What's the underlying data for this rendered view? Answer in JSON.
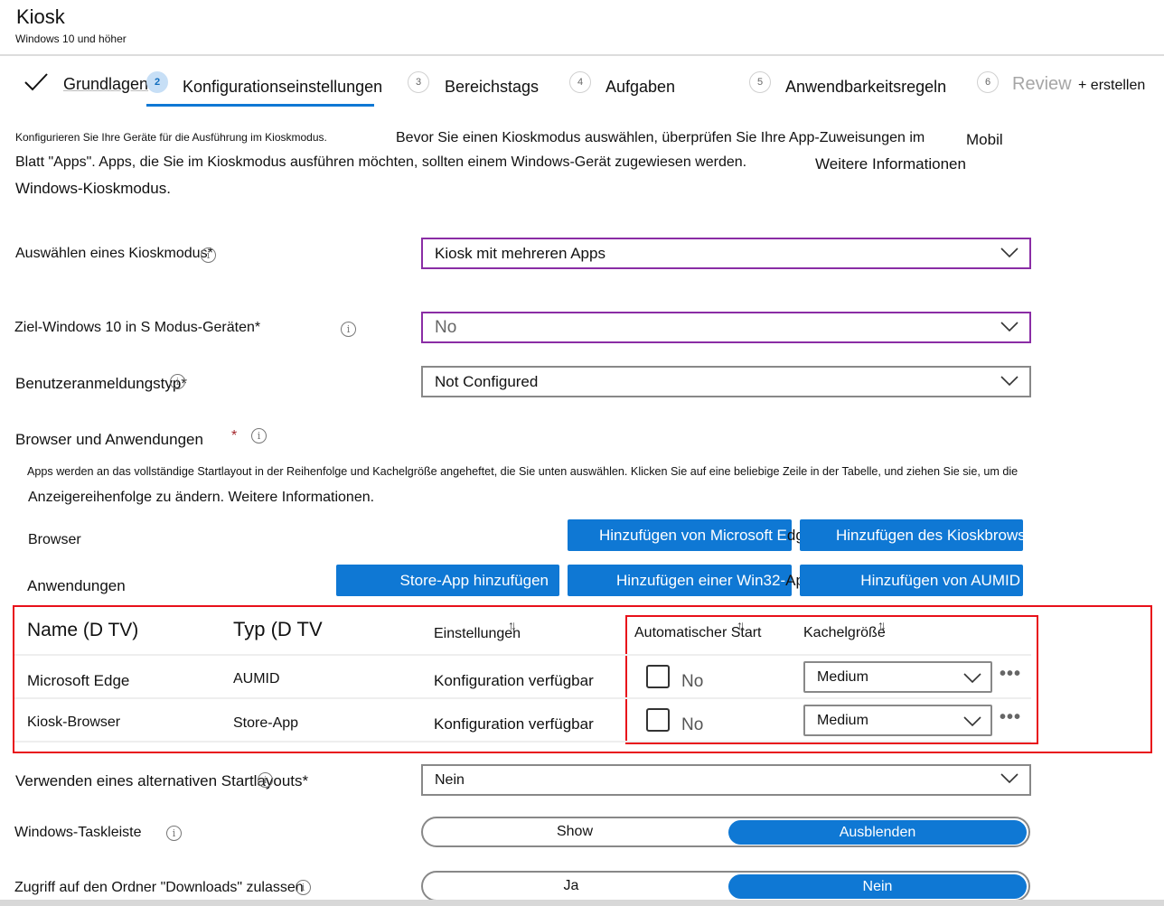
{
  "header": {
    "title": "Kiosk",
    "subtitle": "Windows 10 und höher"
  },
  "wizard": {
    "steps": [
      {
        "num": "✓",
        "label": "Grundlagen",
        "state": "done"
      },
      {
        "num": "2",
        "label": "Konfigurationseinstellungen",
        "state": "active"
      },
      {
        "num": "3",
        "label": "Bereichstags",
        "state": "pending"
      },
      {
        "num": "4",
        "label": "Aufgaben",
        "state": "pending"
      },
      {
        "num": "5",
        "label": "Anwendbarkeitsregeln",
        "state": "pending"
      },
      {
        "num": "6",
        "label": "Review",
        "state": "disabled"
      }
    ],
    "create_suffix": "+ erstellen"
  },
  "intro": {
    "line1_small": "Konfigurieren Sie Ihre Geräte für die Ausführung im Kioskmodus.",
    "line1_rest": "Bevor Sie einen Kioskmodus auswählen, überprüfen Sie Ihre App-Zuweisungen im",
    "line1_link": "Mobil",
    "line2": "Blatt \"Apps\". Apps, die Sie im Kioskmodus ausführen möchten, sollten einem Windows-Gerät zugewiesen werden.",
    "line2_link": "Weitere Informationen",
    "line3": "Windows-Kioskmodus."
  },
  "fields": {
    "kiosk_mode": {
      "label": "Auswählen eines Kioskmodus",
      "required": "*",
      "value": "Kiosk mit mehreren Apps"
    },
    "s_mode": {
      "label": "Ziel-Windows 10 in S Modus-Geräten*",
      "value": "No"
    },
    "logon_type": {
      "label": "Benutzeranmeldungstyp",
      "required": "*",
      "value": "Not Configured"
    },
    "browsers_apps": {
      "label": "Browser und Anwendungen",
      "required": "*"
    },
    "alt_start": {
      "label": "Verwenden eines alternativen Startlayouts*",
      "value": "Nein"
    },
    "taskbar": {
      "label": "Windows-Taskleiste",
      "options": [
        "Show",
        "Ausblenden"
      ],
      "selected": "Ausblenden"
    },
    "downloads": {
      "label": "Zugriff auf den Ordner \"Downloads\" zulassen",
      "options": [
        "Ja",
        "Nein"
      ],
      "selected": "Nein"
    }
  },
  "apps_section": {
    "desc_line1": "Apps werden an das vollständige Startlayout in der Reihenfolge und Kachelgröße angeheftet, die Sie unten auswählen. Klicken Sie auf eine beliebige Zeile in der Tabelle, und ziehen Sie sie, um die",
    "desc_line2": "Anzeigereihenfolge zu ändern. Weitere Informationen.",
    "browser_label": "Browser",
    "apps_label": "Anwendungen",
    "buttons": {
      "add_edge": "Hinzufügen von Microsoft E",
      "add_edge_overflow": "dge",
      "add_kiosk_browser": "Hinzufügen des Kioskbrows",
      "add_store_app": "Store-App hinzufügen",
      "add_win32": "Hinzufügen einer Win32-",
      "add_win32_overflow": "App",
      "add_aumid": "Hinzufügen von AUMID"
    }
  },
  "table": {
    "columns": [
      "Name (D TV)",
      "Typ (D TV",
      "Einstellungen",
      "Automatischer Start",
      "Kachelgröße"
    ],
    "rows": [
      {
        "name": "Microsoft Edge",
        "type": "AUMID",
        "settings": "Konfiguration verfügbar",
        "autostart": "No",
        "tile_size": "Medium"
      },
      {
        "name": "Kiosk-Browser",
        "type": "Store-App",
        "settings": "Konfiguration verfügbar",
        "autostart": "No",
        "tile_size": "Medium"
      }
    ]
  },
  "colors": {
    "accent": "#0f78d4",
    "focus_border": "#8a2da5",
    "highlight_box": "#e8101a",
    "required": "#a4262c"
  }
}
